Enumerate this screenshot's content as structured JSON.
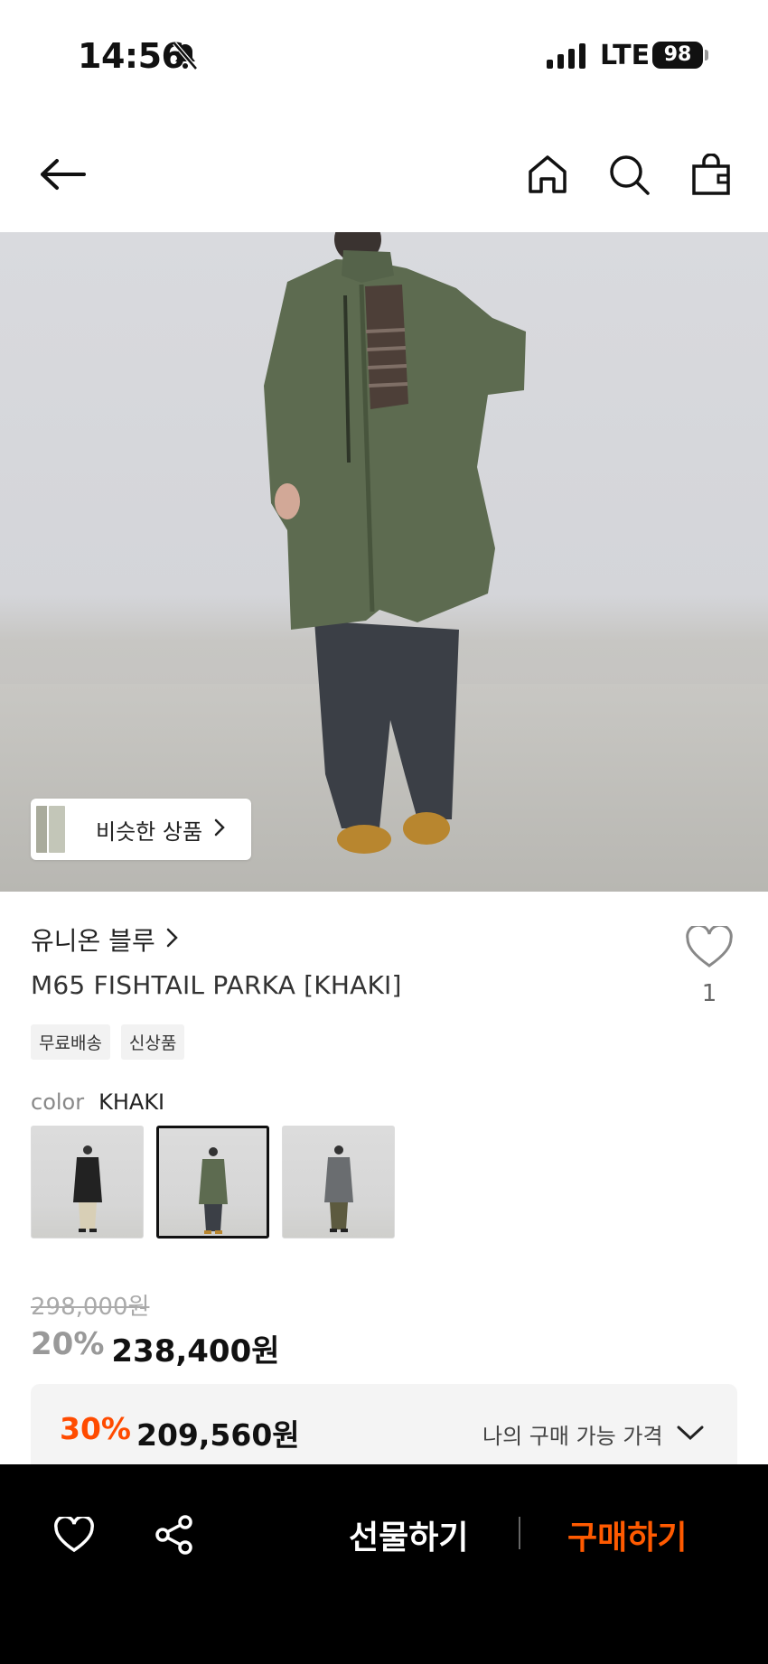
{
  "status": {
    "time": "14:56",
    "network": "LTE",
    "battery": "98"
  },
  "hero": {
    "similar_label": "비슷한 상품"
  },
  "product": {
    "brand": "유니온 블루",
    "name": "M65 FISHTAIL PARKA [KHAKI]",
    "like_count": "1",
    "tags": [
      "무료배송",
      "신상품"
    ],
    "color_label": "color",
    "color_value": "KHAKI",
    "swatches": [
      "black",
      "khaki",
      "gray"
    ],
    "original_price": "298,000원",
    "discount_pct": "20%",
    "sale_price": "238,400원",
    "my_price": {
      "pct": "30%",
      "price": "209,560원",
      "label": "나의 구매 가능 가격"
    }
  },
  "bottom": {
    "gift_label": "선물하기",
    "buy_label": "구매하기"
  },
  "colors": {
    "accent": "#ff4b00",
    "buy": "#ff5a00",
    "parka": "#5d6b50"
  },
  "icons": [
    "bell-slash-icon",
    "signal-icon",
    "back-arrow-icon",
    "home-icon",
    "search-icon",
    "bag-icon",
    "heart-icon",
    "share-icon",
    "chevron-right-icon",
    "chevron-down-icon"
  ]
}
